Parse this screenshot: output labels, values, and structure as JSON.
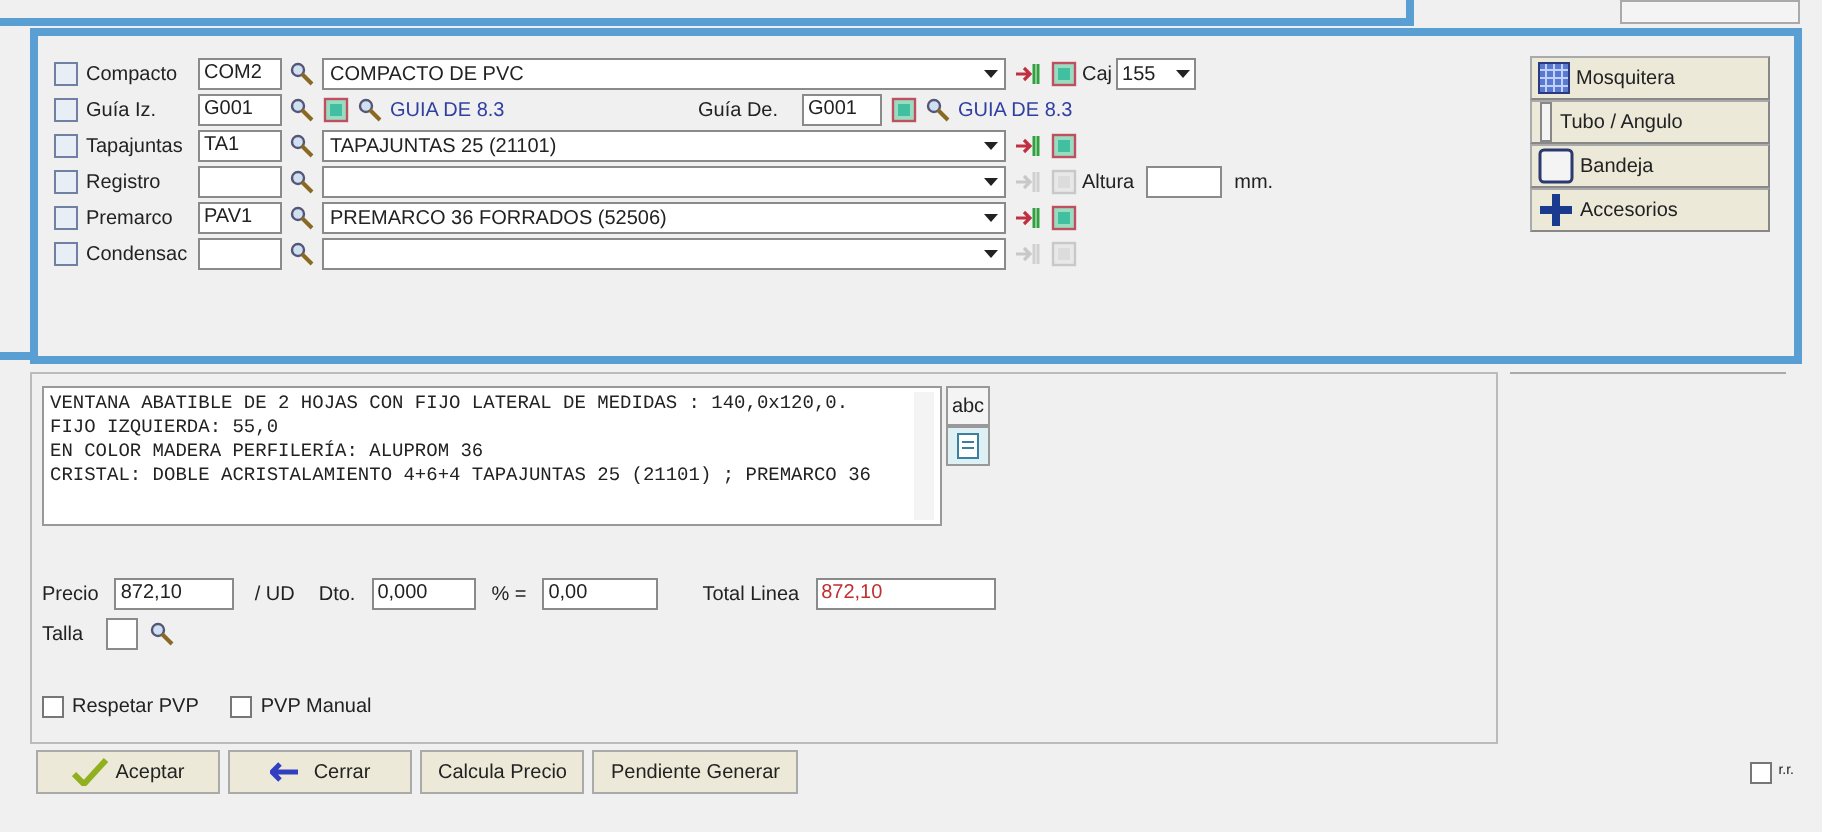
{
  "profiles": [
    {
      "kind": "combo",
      "label": "Compacto",
      "code": "COM2",
      "description": "COMPACTO DE PVC",
      "enabled": true
    },
    {
      "kind": "guide",
      "label": "Guía Iz.",
      "code": "G001",
      "description": "GUIA DE 8.3",
      "right_label": "Guía De.",
      "right_code": "G001",
      "right_description": "GUIA DE 8.3"
    },
    {
      "kind": "combo",
      "label": "Tapajuntas",
      "code": "TA1",
      "description": "TAPAJUNTAS 25 (21101)",
      "enabled": true
    },
    {
      "kind": "combo",
      "label": "Registro",
      "enabled": false
    },
    {
      "kind": "combo",
      "label": "Premarco",
      "code": "PAV1",
      "description": "PREMARCO 36 FORRADOS (52506)",
      "enabled": true
    },
    {
      "kind": "combo",
      "label": "Condensac",
      "enabled": false
    }
  ],
  "caj": {
    "label": "Caj",
    "value": "155"
  },
  "altura": {
    "label": "Altura",
    "unit": "mm."
  },
  "side_buttons": [
    {
      "kind": "grid",
      "label": "Mosquitera"
    },
    {
      "kind": "tube",
      "label": "Tubo / Angulo"
    },
    {
      "kind": "tray",
      "label": "Bandeja"
    },
    {
      "kind": "plus",
      "label": "Accesorios"
    }
  ],
  "description_lines": [
    "VENTANA ABATIBLE DE 2 HOJAS CON FIJO LATERAL DE MEDIDAS : 140,0x120,0.",
    "FIJO IZQUIERDA: 55,0",
    "EN COLOR MADERA PERFILERÍA: ALUPROM 36",
    "CRISTAL: DOBLE ACRISTALAMIENTO 4+6+4 TAPAJUNTAS 25 (21101) ; PREMARCO 36"
  ],
  "spell_button": "abc",
  "price": {
    "label": "Precio",
    "value": "872,10",
    "unit": "/ UD",
    "discount_label": "Dto.",
    "discount": "0,000",
    "percent_label": "% =",
    "percent": "0,00",
    "total_label": "Total Linea",
    "total": "872,10"
  },
  "talla": {
    "label": "Talla"
  },
  "checks": [
    {
      "label": "Respetar PVP",
      "checked": false
    },
    {
      "label": "PVP Manual",
      "checked": false
    }
  ],
  "buttons": [
    {
      "kind": "ok",
      "label": "Aceptar"
    },
    {
      "kind": "close",
      "label": "Cerrar"
    },
    {
      "kind": "plain",
      "label": "Calcula Precio"
    },
    {
      "kind": "plain",
      "label": "Pendiente Generar"
    }
  ],
  "corner_check": {
    "label": "r.r.",
    "checked": false
  }
}
